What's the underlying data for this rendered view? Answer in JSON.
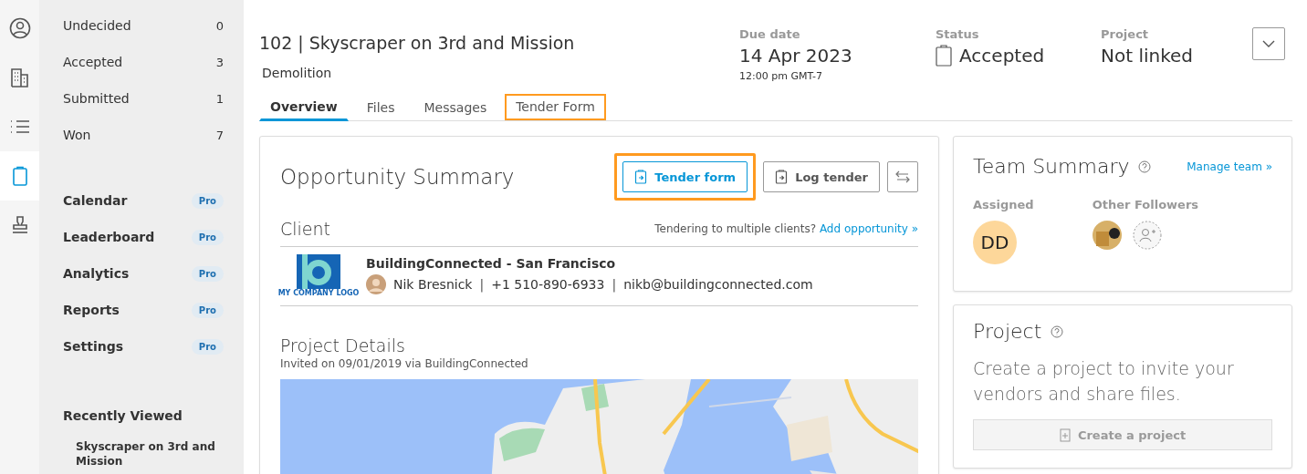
{
  "rail": [
    {
      "kind": "person",
      "selected": false
    },
    {
      "kind": "building",
      "selected": false
    },
    {
      "kind": "list",
      "selected": false
    },
    {
      "kind": "clipboard",
      "selected": true
    },
    {
      "kind": "stamp",
      "selected": false
    }
  ],
  "nav": {
    "counts": [
      {
        "label": "Undecided",
        "count": "0"
      },
      {
        "label": "Accepted",
        "count": "3"
      },
      {
        "label": "Submitted",
        "count": "1"
      },
      {
        "label": "Won",
        "count": "7"
      }
    ],
    "pro_items": [
      {
        "label": "Calendar",
        "badge": "Pro"
      },
      {
        "label": "Leaderboard",
        "badge": "Pro"
      },
      {
        "label": "Analytics",
        "badge": "Pro"
      },
      {
        "label": "Reports",
        "badge": "Pro"
      },
      {
        "label": "Settings",
        "badge": "Pro"
      }
    ],
    "recent": {
      "title": "Recently Viewed",
      "items": [
        "Skyscraper on 3rd and Mission"
      ]
    }
  },
  "header": {
    "title": "102 | Skyscraper on 3rd and Mission",
    "subtitle": "Demolition",
    "fields": [
      {
        "kind": "date",
        "label": "Due date",
        "value": "14 Apr 2023",
        "note": "12:00 pm GMT-7"
      },
      {
        "kind": "status",
        "label": "Status",
        "value": "Accepted"
      },
      {
        "kind": "plain",
        "label": "Project",
        "value": "Not linked"
      }
    ],
    "tabs": [
      {
        "label": "Overview",
        "selected": true,
        "highlighted": false
      },
      {
        "label": "Files",
        "selected": false,
        "highlighted": false
      },
      {
        "label": "Messages",
        "selected": false,
        "highlighted": false
      },
      {
        "label": "Tender Form",
        "selected": false,
        "highlighted": true
      }
    ]
  },
  "summary": {
    "title": "Opportunity Summary",
    "buttons": [
      {
        "kind": "primary",
        "label": "Tender form",
        "highlighted": true
      },
      {
        "kind": "secondary",
        "label": "Log tender",
        "highlighted": false
      }
    ],
    "client": {
      "heading": "Client",
      "prompt": "Tendering to multiple clients?",
      "link": "Add opportunity »",
      "logo_text": "MY COMPANY LOGO",
      "name": "BuildingConnected - San Francisco",
      "contact": "Nik Bresnick",
      "separator": "|",
      "phone": "+1 510-890-6933",
      "email": "nikb@buildingconnected.com"
    },
    "details": {
      "title": "Project Details",
      "invited": "Invited on 09/01/2019 via BuildingConnected"
    }
  },
  "team": {
    "title": "Team Summary",
    "link": "Manage team »",
    "assigned_label": "Assigned",
    "initials": "DD",
    "followers_label": "Other Followers"
  },
  "project": {
    "title": "Project",
    "text": "Create a project to invite your vendors and share files.",
    "button": {
      "label": "Create a project",
      "disabled": true
    }
  }
}
